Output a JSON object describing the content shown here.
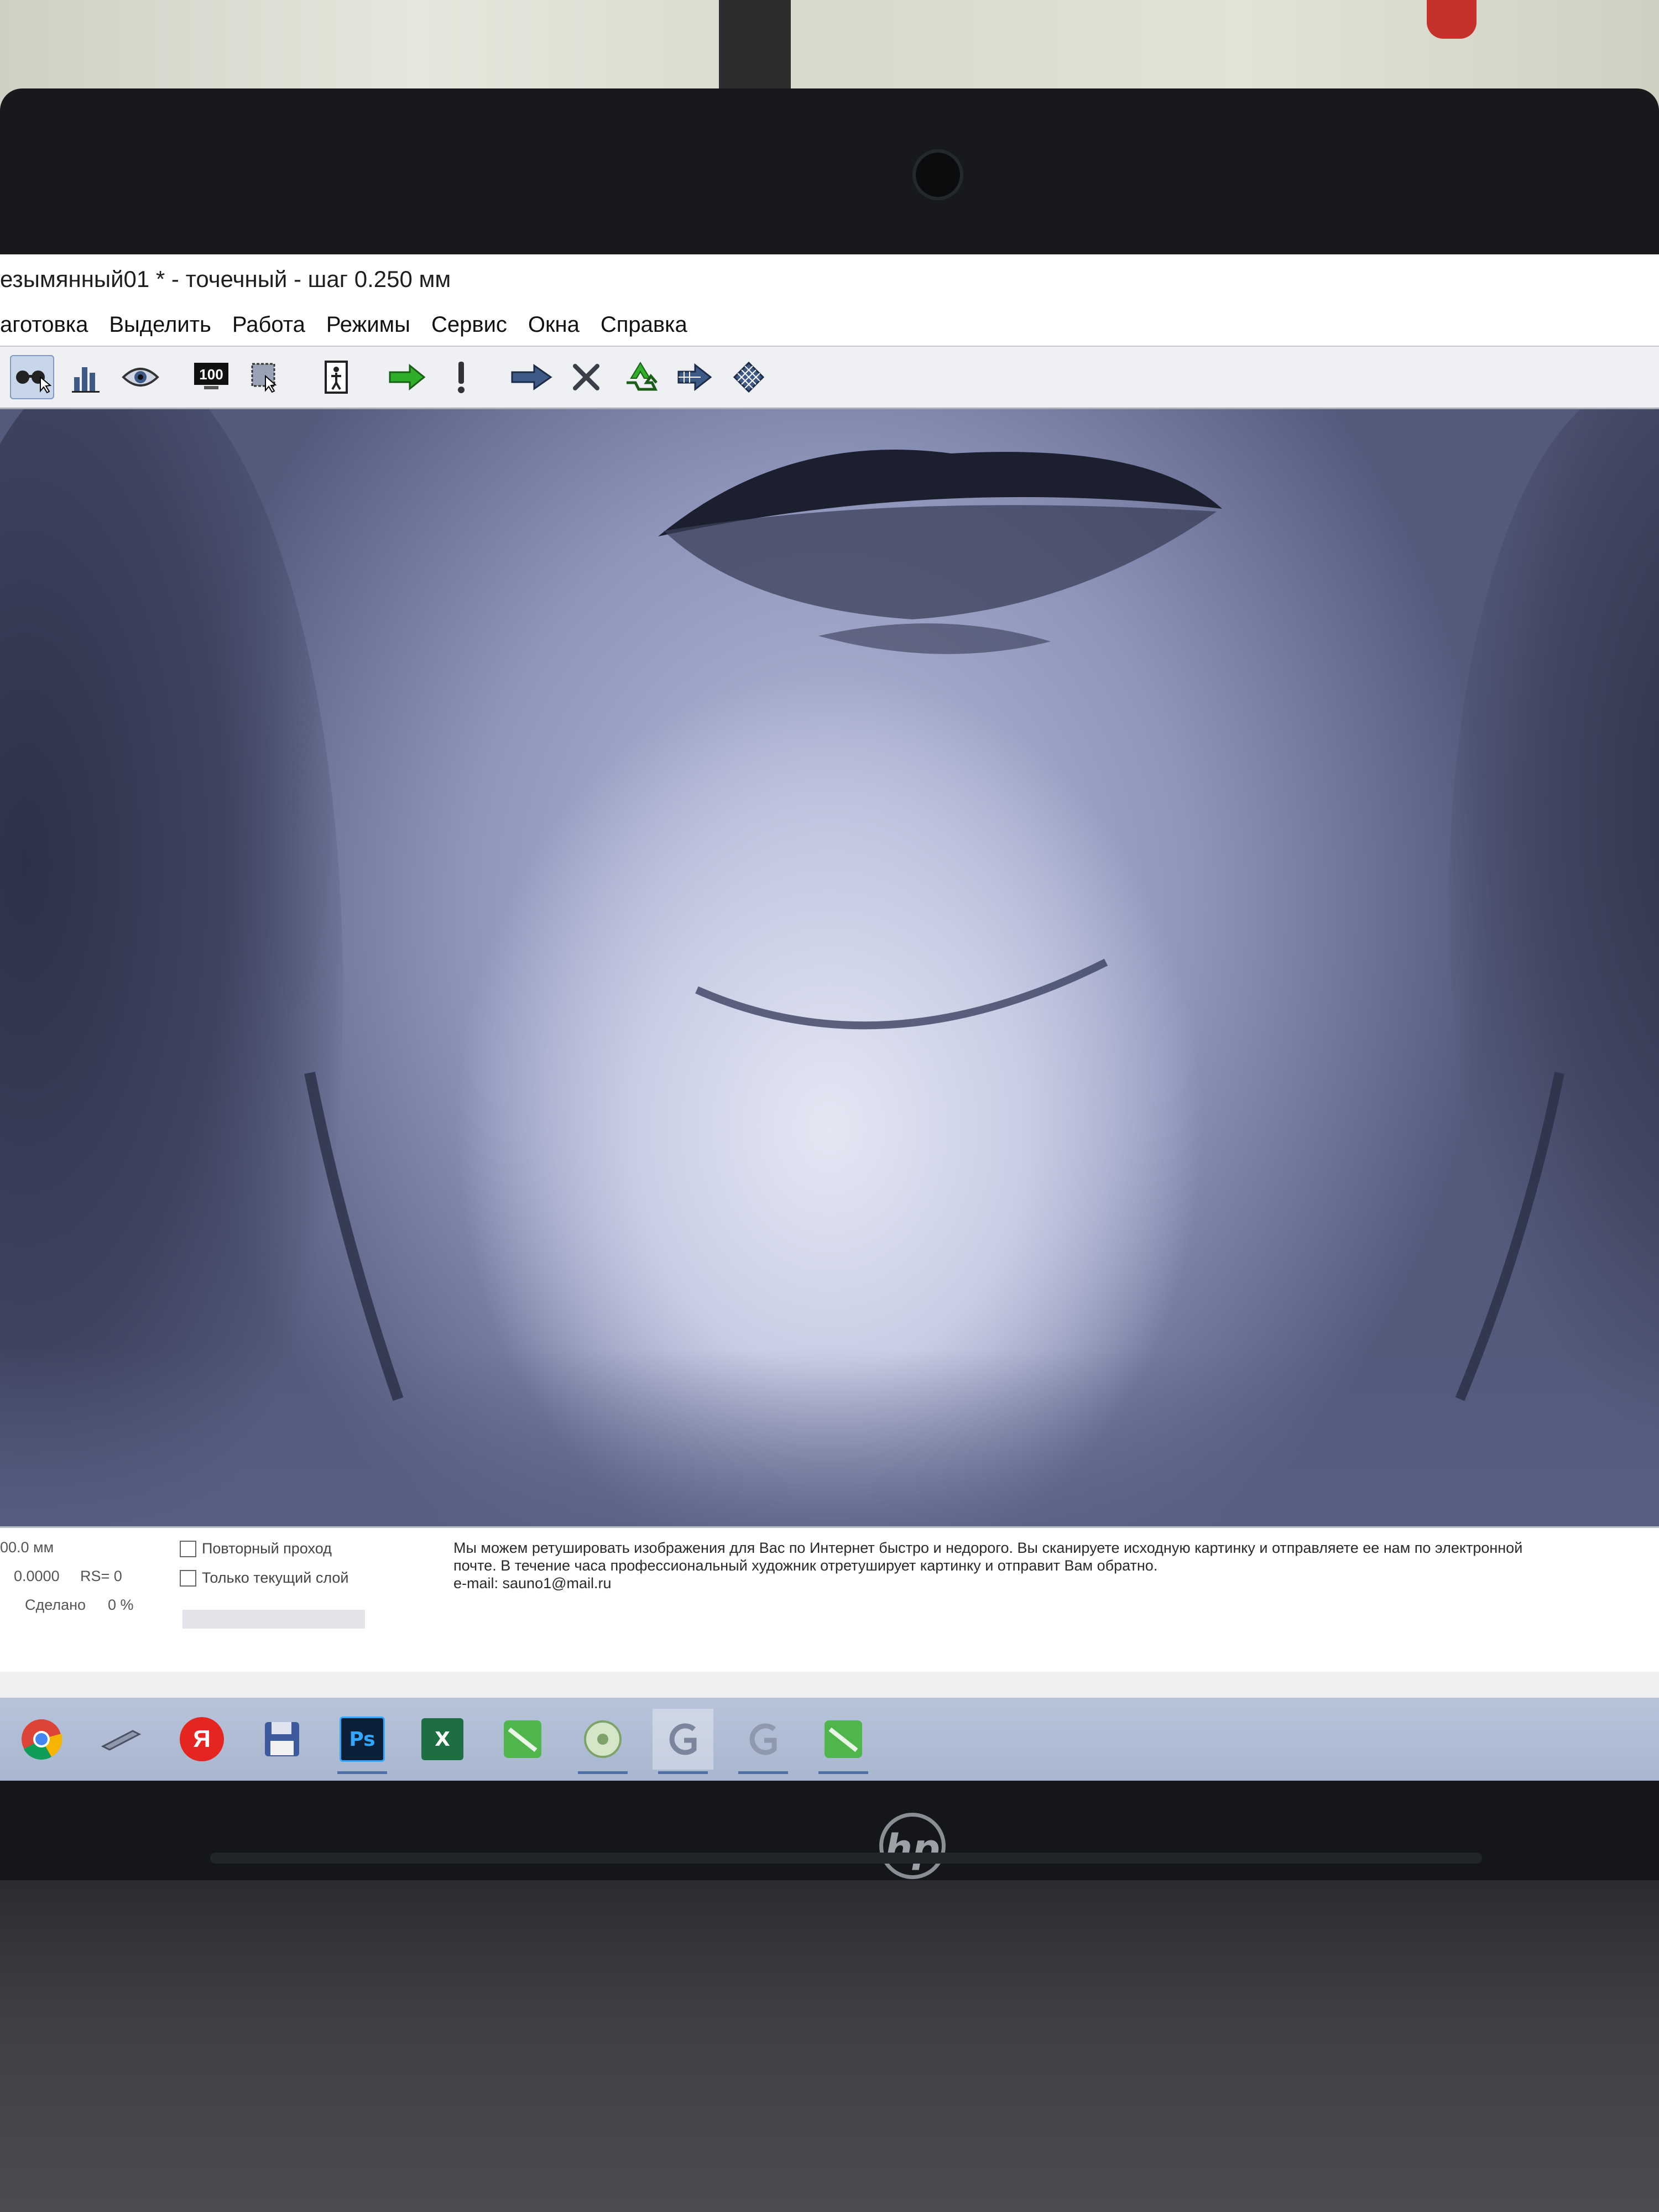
{
  "window": {
    "title": "езымянный01 * - точечный - шаг 0.250 мм"
  },
  "menu": {
    "items": [
      {
        "label": "аготовка"
      },
      {
        "label": "Выделить"
      },
      {
        "label": "Работа"
      },
      {
        "label": "Режимы"
      },
      {
        "label": "Сервис"
      },
      {
        "label": "Окна"
      },
      {
        "label": "Справка"
      }
    ]
  },
  "toolbar": {
    "buttons": [
      {
        "icon": "glasses-icon",
        "active": true
      },
      {
        "icon": "bar-chart-icon"
      },
      {
        "icon": "eye-icon"
      },
      {
        "icon": "zoom-100-icon",
        "label": "100"
      },
      {
        "icon": "select-area-icon"
      },
      {
        "icon": "figure-icon"
      },
      {
        "icon": "green-arrow-right-icon"
      },
      {
        "icon": "exclamation-icon"
      },
      {
        "icon": "double-arrow-icon"
      },
      {
        "icon": "cross-icon"
      },
      {
        "icon": "recycle-icon"
      },
      {
        "icon": "arrow-grid-icon"
      },
      {
        "icon": "grid-icon"
      }
    ]
  },
  "status": {
    "size": "00.0 мм",
    "value": "0.0000",
    "rs": "RS= 0",
    "done_label": "Сделано",
    "done_value": "0 %",
    "checkbox_repeat": "Повторный проход",
    "checkbox_current_layer": "Только текущий слой",
    "ad_lines": [
      "Мы можем ретушировать изображения для Вас по Интернет быстро и недорого. Вы сканируете исходную картинку и отправляете ее нам по электронной",
      "почте. В течение часа профессиональный художник отретуширует картинку и отправит Вам обратно.",
      "e-mail: sauno1@mail.ru"
    ]
  },
  "taskbar": {
    "items": [
      {
        "icon": "chrome-icon"
      },
      {
        "icon": "pen-icon"
      },
      {
        "icon": "yandex-icon",
        "label": "Я"
      },
      {
        "icon": "floppy-icon"
      },
      {
        "icon": "photoshop-icon",
        "label": "Ps",
        "running": true
      },
      {
        "icon": "excel-icon",
        "label": "X"
      },
      {
        "icon": "green-app-icon"
      },
      {
        "icon": "disc-app-icon",
        "running": true
      },
      {
        "icon": "graphic-app-icon",
        "running": true,
        "selected": true
      },
      {
        "icon": "graphic-app-icon-2",
        "running": true
      },
      {
        "icon": "green-app-icon-2",
        "running": true
      }
    ]
  },
  "colors": {
    "taskbar": "#a8b6cf",
    "canvas_tint": "#8e95bb",
    "toolbar_green": "#2fae2a",
    "toolbar_blue": "#3d5a86"
  },
  "device": {
    "brand": "hp"
  }
}
